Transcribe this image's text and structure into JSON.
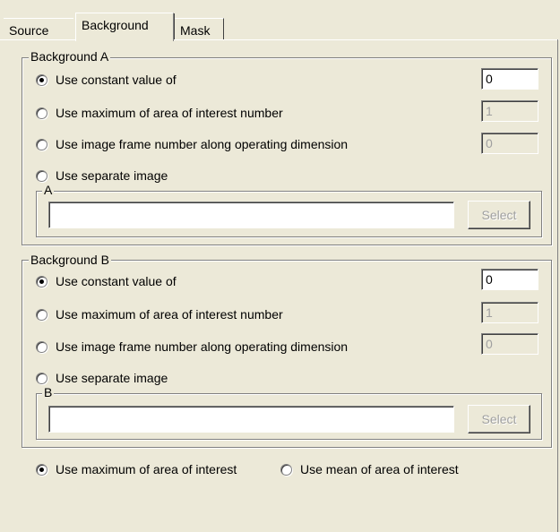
{
  "tabs": {
    "source": "Source",
    "background": "Background",
    "mask": "Mask"
  },
  "background_a": {
    "title": "Background A",
    "options": [
      {
        "label": "Use constant value of",
        "checked": true,
        "value": "0",
        "enabled": true
      },
      {
        "label": "Use maximum of area of interest number",
        "checked": false,
        "value": "1",
        "enabled": false
      },
      {
        "label": "Use image frame number along operating dimension",
        "checked": false,
        "value": "0",
        "enabled": false
      },
      {
        "label": "Use separate image",
        "checked": false
      }
    ],
    "image_group_title": "A",
    "image_path": "",
    "select_label": "Select"
  },
  "background_b": {
    "title": "Background B",
    "options": [
      {
        "label": "Use constant value of",
        "checked": true,
        "value": "0",
        "enabled": true
      },
      {
        "label": "Use maximum of area of interest number",
        "checked": false,
        "value": "1",
        "enabled": false
      },
      {
        "label": "Use image frame number along operating dimension",
        "checked": false,
        "value": "0",
        "enabled": false
      },
      {
        "label": "Use separate image",
        "checked": false
      }
    ],
    "image_group_title": "B",
    "image_path": "",
    "select_label": "Select"
  },
  "aoi_mode": {
    "max_label": "Use maximum of area of interest",
    "mean_label": "Use mean of area of interest",
    "selected": "max"
  }
}
